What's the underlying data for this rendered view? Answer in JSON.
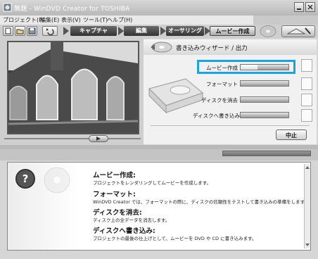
{
  "window": {
    "title": "WinDVD Creator for TOSHIBA",
    "title_prefix": "無題 -"
  },
  "menu": [
    "プロジェクト(P)",
    "編集(E)",
    "表示(V)",
    "ツール(T)",
    "ヘルプ(H)"
  ],
  "stages": {
    "capture": "キャプチャ",
    "edit": "編集",
    "authoring": "オーサリング",
    "movie": "ムービー作成"
  },
  "wizard": {
    "header": "書き込みウィザード / 出力",
    "options": [
      {
        "label": "ムービー作成"
      },
      {
        "label": "フォーマット"
      },
      {
        "label": "ディスクを消去"
      },
      {
        "label": "ディスクへ書き込み"
      }
    ],
    "stop_label": "中止"
  },
  "info": {
    "items": [
      {
        "title": "ムービー作成:",
        "desc": "プロジェクトをレンダリングしてムービーを作成します。"
      },
      {
        "title": "フォーマット:",
        "desc": "WinDVD Creator では、フォーマットの際に、ディスクの信頼性をテストして書き込みの準備をします。"
      },
      {
        "title": "ディスクを消去:",
        "desc": "ディスク上の全データを消去します。"
      },
      {
        "title": "ディスクへ書き込み:",
        "desc": "プロジェクトの最後の仕上げとして、ムービーを DVD や CD に書き込みます。"
      }
    ]
  },
  "icons": {
    "app": "app-logo-icon",
    "help": "question-icon",
    "disc": "disc-icon"
  },
  "colors": {
    "highlight": "#1aa3e6",
    "stage_dark": "#444444",
    "stage_active": "#d0d0d0"
  }
}
